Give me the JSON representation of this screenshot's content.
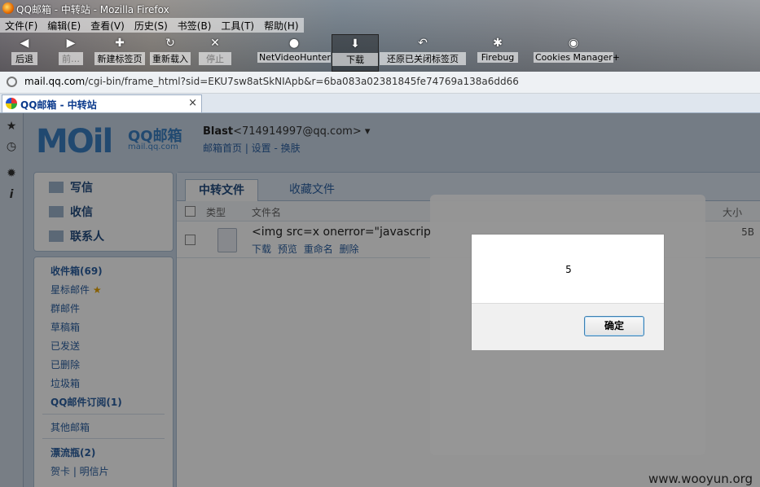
{
  "window": {
    "title": "QQ邮箱 - 中转站 - Mozilla Firefox"
  },
  "menu": [
    "文件(F)",
    "编辑(E)",
    "查看(V)",
    "历史(S)",
    "书签(B)",
    "工具(T)",
    "帮助(H)"
  ],
  "toolbar": {
    "back": "后退",
    "forward": "前…",
    "new_tab": "新建标签页",
    "reload": "重新载入",
    "stop": "停止",
    "netvideohunter": "NetVideoHunter",
    "download": "下载",
    "restore_tab": "还原已关闭标签页",
    "firebug": "Firebug",
    "cookies_manager": "Cookies Manager+"
  },
  "address": {
    "domain": "mail.qq.com",
    "path": "/cgi-bin/frame_html?sid=EKU7sw8atSkNIApb&r=6ba083a02381845fe74769a138a6dd66"
  },
  "tab": {
    "label": "QQ邮箱 - 中转站",
    "close": "×"
  },
  "header": {
    "logo": "MOil",
    "logo_cn": "QQ邮箱",
    "logo_domain": "mail.qq.com",
    "account_name": "Blast",
    "account_email": "<714914997@qq.com>",
    "links": "邮箱首页 | 设置 - 换肤"
  },
  "quick_actions": [
    "写信",
    "收信",
    "联系人"
  ],
  "folders": {
    "inbox": "收件箱(69)",
    "starred": "星标邮件",
    "group": "群邮件",
    "drafts": "草稿箱",
    "sent": "已发送",
    "deleted": "已删除",
    "spam": "垃圾箱",
    "subscription": "QQ邮件订阅(1)",
    "other": "其他邮箱",
    "drift": "漂流瓶(2)",
    "cards": "贺卡 | 明信片"
  },
  "main": {
    "tabs": [
      "中转文件",
      "收藏文件"
    ],
    "columns": {
      "type": "类型",
      "name": "文件名",
      "size": "大小"
    },
    "file": {
      "name": "<img src=x onerror=\"javascrip",
      "actions": [
        "下载",
        "预览",
        "重命名",
        "删除"
      ],
      "size": "5B"
    }
  },
  "dialog": {
    "message": "5",
    "ok": "确定"
  },
  "watermark": "www.wooyun.org"
}
